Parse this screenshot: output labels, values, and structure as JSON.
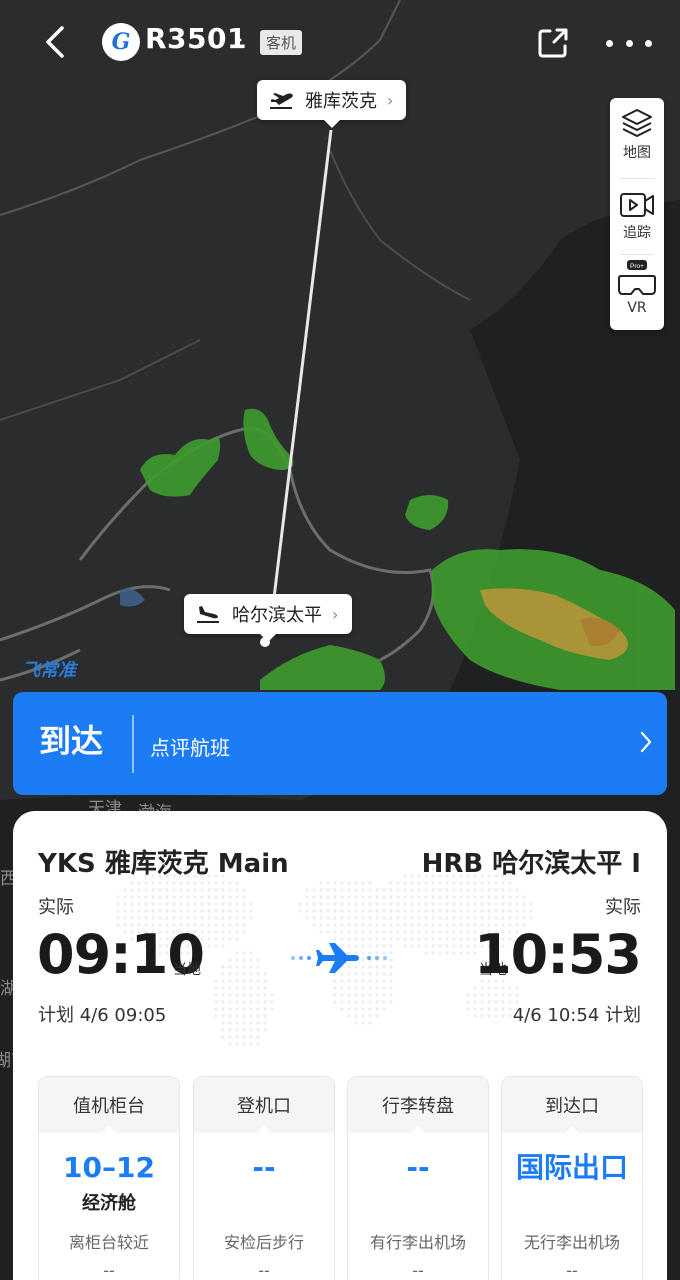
{
  "header": {
    "flight_number": "R3501",
    "aircraft_type_badge": "客机",
    "logo_glyph": "G"
  },
  "map": {
    "departure_callout": "雅库茨克",
    "arrival_callout": "哈尔滨太平",
    "watermark": "飞常准",
    "labels": [
      "天津",
      "渤海",
      "西",
      "湖",
      "湖南"
    ]
  },
  "map_controls": {
    "layers_label": "地图",
    "track_label": "追踪",
    "vr_label": "VR",
    "vr_badge": "Pro+"
  },
  "status_bar": {
    "status": "到达",
    "review_label": "点评航班"
  },
  "departure": {
    "code_name": "YKS 雅库茨克 Main",
    "time_label": "实际",
    "time": "09:10",
    "local_tag": "当地",
    "scheduled": "计划 4/6 09:05"
  },
  "arrival": {
    "code_name": "HRB 哈尔滨太平 I",
    "time_label": "实际",
    "time": "10:53",
    "local_tag": "当地",
    "scheduled": "4/6 10:54 计划"
  },
  "tiles": [
    {
      "title": "值机柜台",
      "value": "10–12",
      "sub": "经济舱",
      "note": "离柜台较近",
      "extra": "--"
    },
    {
      "title": "登机口",
      "value": "--",
      "sub": "",
      "note": "安检后步行",
      "extra": "--"
    },
    {
      "title": "行李转盘",
      "value": "--",
      "sub": "",
      "note": "有行李出机场",
      "extra": "--"
    },
    {
      "title": "到达口",
      "value": "国际出口",
      "sub": "",
      "note": "无行李出机场",
      "extra": "--"
    }
  ],
  "colors": {
    "accent": "#1c7cf4",
    "map_bg": "#2b2c2e",
    "radar_green": "#3e9b2e",
    "radar_yellow": "#b9a23a"
  }
}
